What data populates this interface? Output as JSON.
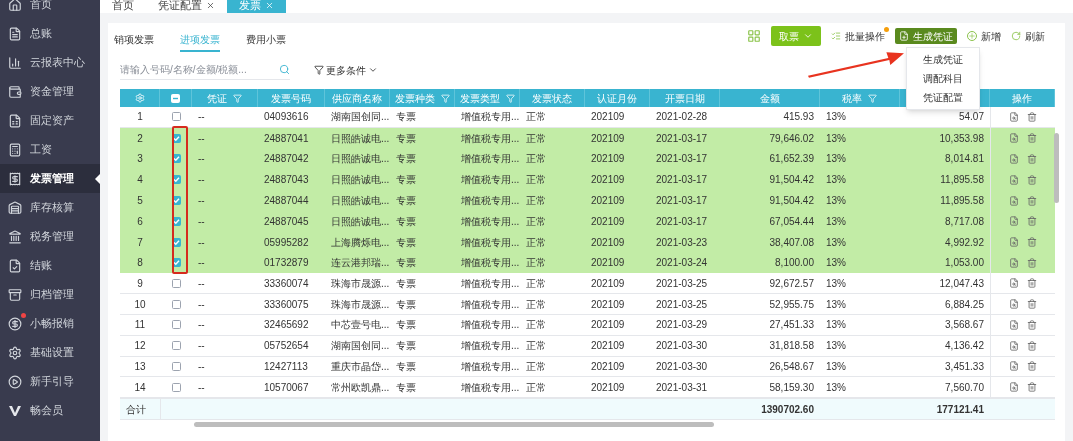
{
  "sidebar": {
    "items": [
      {
        "label": "首页",
        "selected": false,
        "dot": false
      },
      {
        "label": "总账",
        "selected": false,
        "dot": false
      },
      {
        "label": "云报表中心",
        "selected": false,
        "dot": false
      },
      {
        "label": "资金管理",
        "selected": false,
        "dot": false
      },
      {
        "label": "固定资产",
        "selected": false,
        "dot": false
      },
      {
        "label": "工资",
        "selected": false,
        "dot": false
      },
      {
        "label": "发票管理",
        "selected": true,
        "dot": false
      },
      {
        "label": "库存核算",
        "selected": false,
        "dot": false
      },
      {
        "label": "税务管理",
        "selected": false,
        "dot": false
      },
      {
        "label": "结账",
        "selected": false,
        "dot": false
      },
      {
        "label": "归档管理",
        "selected": false,
        "dot": false
      },
      {
        "label": "小畅报销",
        "selected": false,
        "dot": true
      },
      {
        "label": "基础设置",
        "selected": false,
        "dot": false
      },
      {
        "label": "新手引导",
        "selected": false,
        "dot": false
      },
      {
        "label": "畅会员",
        "selected": false,
        "dot": false
      }
    ]
  },
  "top_tabs": [
    {
      "label": "首页",
      "closable": false,
      "selected": false
    },
    {
      "label": "凭证配置",
      "closable": true,
      "selected": false
    },
    {
      "label": "发票",
      "closable": true,
      "selected": true
    }
  ],
  "sub_tabs": [
    {
      "label": "销项发票",
      "selected": false
    },
    {
      "label": "进项发票",
      "selected": true
    },
    {
      "label": "费用小票",
      "selected": false
    }
  ],
  "search": {
    "placeholder": "请输入号码/名称/金额/税额..."
  },
  "filter_button": "更多条件",
  "toolbar": {
    "fetch_button": "取票",
    "batch_button": "批量操作",
    "generate_button": "生成凭证",
    "add_button": "新增",
    "refresh_button": "刷新"
  },
  "dropdown_menu": [
    "生成凭证",
    "调配科目",
    "凭证配置"
  ],
  "table": {
    "columns": [
      {
        "kind": "settings"
      },
      {
        "kind": "checkbox",
        "indeterminate": true
      },
      {
        "kind": "text",
        "label": "凭证",
        "filter": true
      },
      {
        "kind": "text",
        "label": "发票号码",
        "filter": false
      },
      {
        "kind": "text",
        "label": "供应商名称",
        "filter": false
      },
      {
        "kind": "text",
        "label": "发票种类",
        "filter": true
      },
      {
        "kind": "text",
        "label": "发票类型",
        "filter": true
      },
      {
        "kind": "text",
        "label": "发票状态",
        "filter": false
      },
      {
        "kind": "text",
        "label": "认证月份",
        "filter": false
      },
      {
        "kind": "text",
        "label": "开票日期",
        "filter": false
      },
      {
        "kind": "text",
        "label": "金额",
        "filter": false
      },
      {
        "kind": "text",
        "label": "税率",
        "filter": true
      },
      {
        "kind": "text"
      },
      {
        "kind": "text",
        "label": "操作",
        "filter": false
      }
    ],
    "rows": [
      {
        "index": "1",
        "checked": false,
        "voucher": "--",
        "number": "04093616",
        "supplier": "湖南国创同...",
        "kind": "专票",
        "type": "增值税专用...",
        "status": "正常",
        "month": "202109",
        "date": "2021-02-28",
        "amount": "415.93",
        "rate": "13%",
        "tax": "54.07"
      },
      {
        "index": "2",
        "checked": true,
        "voucher": "--",
        "number": "24887041",
        "supplier": "日照皓诚电...",
        "kind": "专票",
        "type": "增值税专用...",
        "status": "正常",
        "month": "202109",
        "date": "2021-03-17",
        "amount": "79,646.02",
        "rate": "13%",
        "tax": "10,353.98"
      },
      {
        "index": "3",
        "checked": true,
        "voucher": "--",
        "number": "24887042",
        "supplier": "日照皓诚电...",
        "kind": "专票",
        "type": "增值税专用...",
        "status": "正常",
        "month": "202109",
        "date": "2021-03-17",
        "amount": "61,652.39",
        "rate": "13%",
        "tax": "8,014.81"
      },
      {
        "index": "4",
        "checked": true,
        "voucher": "--",
        "number": "24887043",
        "supplier": "日照皓诚电...",
        "kind": "专票",
        "type": "增值税专用...",
        "status": "正常",
        "month": "202109",
        "date": "2021-03-17",
        "amount": "91,504.42",
        "rate": "13%",
        "tax": "11,895.58"
      },
      {
        "index": "5",
        "checked": true,
        "voucher": "--",
        "number": "24887044",
        "supplier": "日照皓诚电...",
        "kind": "专票",
        "type": "增值税专用...",
        "status": "正常",
        "month": "202109",
        "date": "2021-03-17",
        "amount": "91,504.42",
        "rate": "13%",
        "tax": "11,895.58"
      },
      {
        "index": "6",
        "checked": true,
        "voucher": "--",
        "number": "24887045",
        "supplier": "日照皓诚电...",
        "kind": "专票",
        "type": "增值税专用...",
        "status": "正常",
        "month": "202109",
        "date": "2021-03-17",
        "amount": "67,054.44",
        "rate": "13%",
        "tax": "8,717.08"
      },
      {
        "index": "7",
        "checked": true,
        "voucher": "--",
        "number": "05995282",
        "supplier": "上海腾烁电...",
        "kind": "专票",
        "type": "增值税专用...",
        "status": "正常",
        "month": "202109",
        "date": "2021-03-23",
        "amount": "38,407.08",
        "rate": "13%",
        "tax": "4,992.92"
      },
      {
        "index": "8",
        "checked": true,
        "voucher": "--",
        "number": "01732879",
        "supplier": "连云港邦瑞...",
        "kind": "专票",
        "type": "增值税专用...",
        "status": "正常",
        "month": "202109",
        "date": "2021-03-24",
        "amount": "8,100.00",
        "rate": "13%",
        "tax": "1,053.00"
      },
      {
        "index": "9",
        "checked": false,
        "voucher": "--",
        "number": "33360074",
        "supplier": "珠海市晟源...",
        "kind": "专票",
        "type": "增值税专用...",
        "status": "正常",
        "month": "202109",
        "date": "2021-03-25",
        "amount": "92,672.57",
        "rate": "13%",
        "tax": "12,047.43"
      },
      {
        "index": "10",
        "checked": false,
        "voucher": "--",
        "number": "33360075",
        "supplier": "珠海市晟源...",
        "kind": "专票",
        "type": "增值税专用...",
        "status": "正常",
        "month": "202109",
        "date": "2021-03-25",
        "amount": "52,955.75",
        "rate": "13%",
        "tax": "6,884.25"
      },
      {
        "index": "11",
        "checked": false,
        "voucher": "--",
        "number": "32465692",
        "supplier": "中芯壹号电...",
        "kind": "专票",
        "type": "增值税专用...",
        "status": "正常",
        "month": "202109",
        "date": "2021-03-29",
        "amount": "27,451.33",
        "rate": "13%",
        "tax": "3,568.67"
      },
      {
        "index": "12",
        "checked": false,
        "voucher": "--",
        "number": "05752654",
        "supplier": "湖南国创同...",
        "kind": "专票",
        "type": "增值税专用...",
        "status": "正常",
        "month": "202109",
        "date": "2021-03-30",
        "amount": "31,818.58",
        "rate": "13%",
        "tax": "4,136.42"
      },
      {
        "index": "13",
        "checked": false,
        "voucher": "--",
        "number": "12427113",
        "supplier": "重庆市晶岱...",
        "kind": "专票",
        "type": "增值税专用...",
        "status": "正常",
        "month": "202109",
        "date": "2021-03-30",
        "amount": "26,548.67",
        "rate": "13%",
        "tax": "3,451.33"
      },
      {
        "index": "14",
        "checked": false,
        "voucher": "--",
        "number": "10570067",
        "supplier": "常州欧凯鼎...",
        "kind": "专票",
        "type": "增值税专用...",
        "status": "正常",
        "month": "202109",
        "date": "2021-03-31",
        "amount": "58,159.30",
        "rate": "13%",
        "tax": "7,560.70"
      }
    ],
    "totals": {
      "label": "合计",
      "amount": "1390702.60",
      "tax": "177121.41"
    }
  }
}
